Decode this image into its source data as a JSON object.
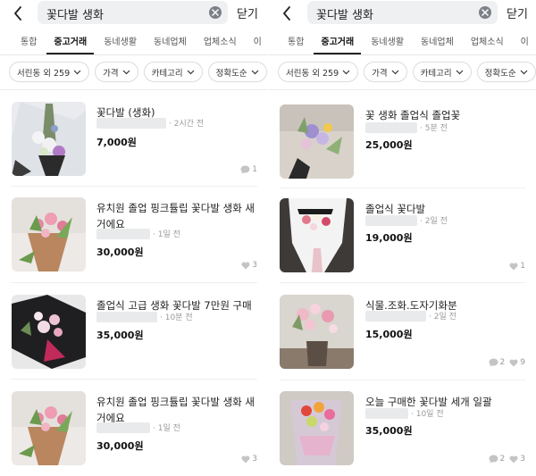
{
  "left": {
    "search_query": "꽃다발 생화",
    "close_label": "닫기",
    "tabs": [
      "통합",
      "중고거래",
      "동네생활",
      "동네업체",
      "업체소식",
      "이"
    ],
    "filters": [
      "서린동 외 259",
      "가격",
      "카테고리",
      "정확도순"
    ],
    "items": [
      {
        "title": "꽃다발 (생화)",
        "time": "· 2시간 전",
        "price": "7,000원",
        "chats": "1",
        "likes": ""
      },
      {
        "title": "유치원 졸업 핑크튤립 꽃다발 생화 새거에요",
        "time": "· 1일 전",
        "price": "30,000원",
        "chats": "",
        "likes": "3"
      },
      {
        "title": "졸업식 고급 생화 꽃다발 7만원 구매",
        "time": "· 10분 전",
        "price": "35,000원",
        "chats": "",
        "likes": ""
      },
      {
        "title": "유치원 졸업 핑크튤립 꽃다발 생화 새거에요",
        "time": "· 1일 전",
        "price": "30,000원",
        "chats": "",
        "likes": "3"
      }
    ]
  },
  "right": {
    "search_query": "꽃다발 생화",
    "close_label": "닫기",
    "tabs": [
      "통합",
      "중고거래",
      "동네생활",
      "동네업체",
      "업체소식",
      "이"
    ],
    "filters": [
      "서린동 외 259",
      "가격",
      "카테고리",
      "정확도순"
    ],
    "items": [
      {
        "title": "꽃 생화 졸업식 졸업꽃",
        "time": "· 5분 전",
        "price": "25,000원",
        "chats": "",
        "likes": ""
      },
      {
        "title": "졸업식 꽃다발",
        "time": "· 2일 전",
        "price": "19,000원",
        "chats": "",
        "likes": "1"
      },
      {
        "title": "식물.조화.도자기화분",
        "time": "· 2일 전",
        "price": "15,000원",
        "chats": "2",
        "likes": "9"
      },
      {
        "title": "오늘 구매한 꽃다발 세개 일괄",
        "time": "· 10일 전",
        "price": "35,000원",
        "chats": "2",
        "likes": "3"
      }
    ]
  },
  "colors": {
    "search_bg": "#eef0f2",
    "active_tab_underline": "#222222",
    "price": "#111111",
    "meta": "#9a9a9a"
  },
  "icons": [
    "back-arrow-icon",
    "clear-icon",
    "chevron-down-icon",
    "chat-bubble-icon",
    "heart-icon"
  ]
}
